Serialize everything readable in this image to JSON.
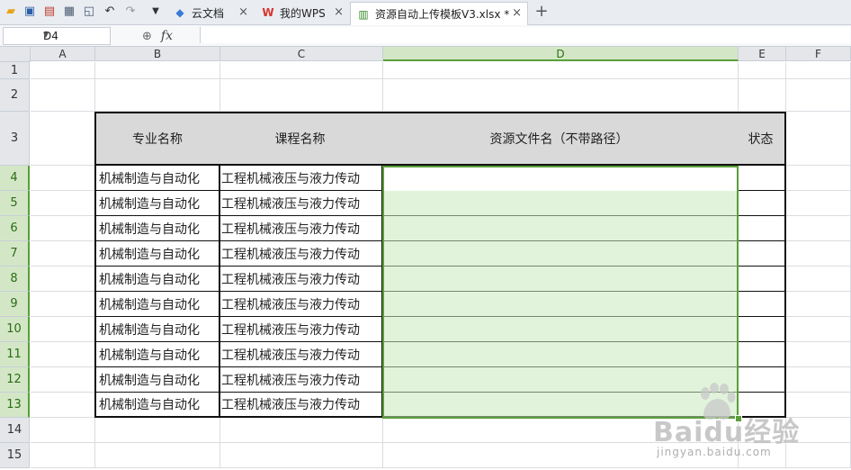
{
  "toolbar": {
    "icons": [
      "open-folder-icon",
      "save-icon",
      "export-pdf-icon",
      "print-icon",
      "print-preview-icon",
      "undo-icon",
      "redo-icon",
      "more-dropdown-icon"
    ]
  },
  "tabs": [
    {
      "label": "云文档",
      "icon": "cloud-icon",
      "active": false
    },
    {
      "label": "我的WPS",
      "icon": "wps-logo-icon",
      "active": false
    },
    {
      "label": "资源自动上传模板V3.xlsx *",
      "icon": "spreadsheet-icon",
      "active": true
    }
  ],
  "new_tab_symbol": "+",
  "close_symbol": "×",
  "formula_bar": {
    "cell_ref": "D4",
    "fx_label": "fx",
    "value": ""
  },
  "columns": [
    "A",
    "B",
    "C",
    "D",
    "E",
    "F"
  ],
  "rows": [
    "1",
    "2",
    "3",
    "4",
    "5",
    "6",
    "7",
    "8",
    "9",
    "10",
    "11",
    "12",
    "13",
    "14",
    "15"
  ],
  "table": {
    "headers": [
      "专业名称",
      "课程名称",
      "资源文件名（不带路径）",
      "状态"
    ],
    "rows": [
      [
        "机械制造与自动化",
        "工程机械液压与液力传动",
        "",
        ""
      ],
      [
        "机械制造与自动化",
        "工程机械液压与液力传动",
        "",
        ""
      ],
      [
        "机械制造与自动化",
        "工程机械液压与液力传动",
        "",
        ""
      ],
      [
        "机械制造与自动化",
        "工程机械液压与液力传动",
        "",
        ""
      ],
      [
        "机械制造与自动化",
        "工程机械液压与液力传动",
        "",
        ""
      ],
      [
        "机械制造与自动化",
        "工程机械液压与液力传动",
        "",
        ""
      ],
      [
        "机械制造与自动化",
        "工程机械液压与液力传动",
        "",
        ""
      ],
      [
        "机械制造与自动化",
        "工程机械液压与液力传动",
        "",
        ""
      ],
      [
        "机械制造与自动化",
        "工程机械液压与液力传动",
        "",
        ""
      ],
      [
        "机械制造与自动化",
        "工程机械液压与液力传动",
        "",
        ""
      ]
    ]
  },
  "selection": {
    "active_cell": "D4",
    "range": "D4:D13",
    "accent": "#5b9e3a"
  },
  "watermark": {
    "brand": "Baidu经验",
    "url": "jingyan.baidu.com"
  }
}
